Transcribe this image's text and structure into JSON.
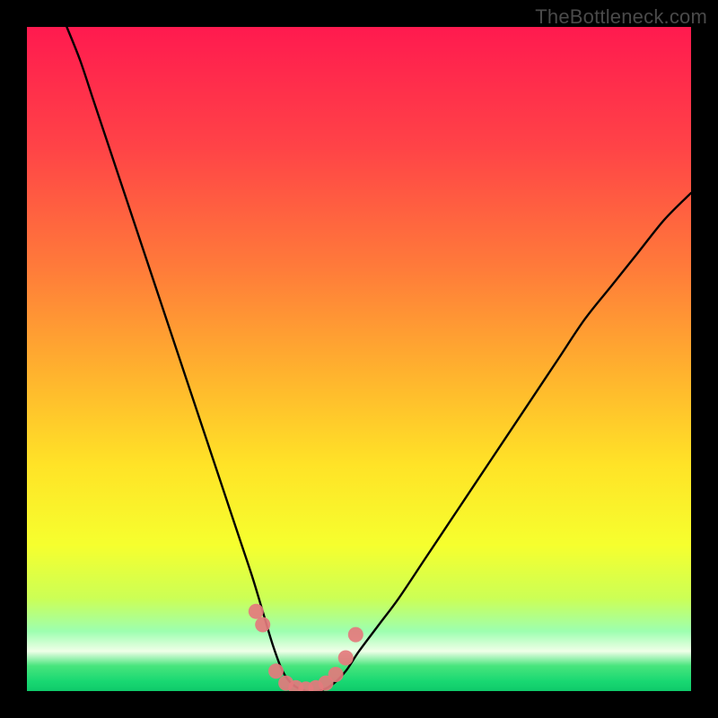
{
  "watermark": "TheBottleneck.com",
  "chart_data": {
    "type": "line",
    "title": "",
    "xlabel": "",
    "ylabel": "",
    "xlim": [
      0,
      100
    ],
    "ylim": [
      0,
      100
    ],
    "series": [
      {
        "name": "bottleneck-curve",
        "x": [
          6,
          8,
          10,
          12,
          14,
          16,
          18,
          20,
          22,
          24,
          26,
          28,
          30,
          32,
          34,
          35.5,
          37,
          38.5,
          40,
          42,
          44,
          46,
          48,
          50,
          53,
          56,
          60,
          64,
          68,
          72,
          76,
          80,
          84,
          88,
          92,
          96,
          100
        ],
        "y": [
          100,
          95,
          89,
          83,
          77,
          71,
          65,
          59,
          53,
          47,
          41,
          35,
          29,
          23,
          17,
          12,
          7,
          3,
          1,
          0,
          0,
          1,
          3,
          6,
          10,
          14,
          20,
          26,
          32,
          38,
          44,
          50,
          56,
          61,
          66,
          71,
          75
        ]
      }
    ],
    "markers": {
      "name": "highlight-points",
      "x": [
        34.5,
        35.5,
        37.5,
        39.0,
        40.5,
        42.0,
        43.5,
        45.0,
        46.5,
        48.0,
        49.5
      ],
      "y": [
        12.0,
        10.0,
        3.0,
        1.2,
        0.5,
        0.3,
        0.5,
        1.2,
        2.5,
        5.0,
        8.5
      ]
    },
    "background_gradient_stops": [
      {
        "offset": 0.0,
        "color": "#ff1a4f"
      },
      {
        "offset": 0.18,
        "color": "#ff4347"
      },
      {
        "offset": 0.36,
        "color": "#ff7a3a"
      },
      {
        "offset": 0.52,
        "color": "#ffb22e"
      },
      {
        "offset": 0.66,
        "color": "#ffe327"
      },
      {
        "offset": 0.78,
        "color": "#f6ff2e"
      },
      {
        "offset": 0.86,
        "color": "#ccff55"
      },
      {
        "offset": 0.91,
        "color": "#9dffb0"
      },
      {
        "offset": 0.94,
        "color": "#f0ffe8"
      },
      {
        "offset": 0.962,
        "color": "#48e57d"
      },
      {
        "offset": 0.985,
        "color": "#19d872"
      },
      {
        "offset": 1.0,
        "color": "#0fca6a"
      }
    ]
  }
}
